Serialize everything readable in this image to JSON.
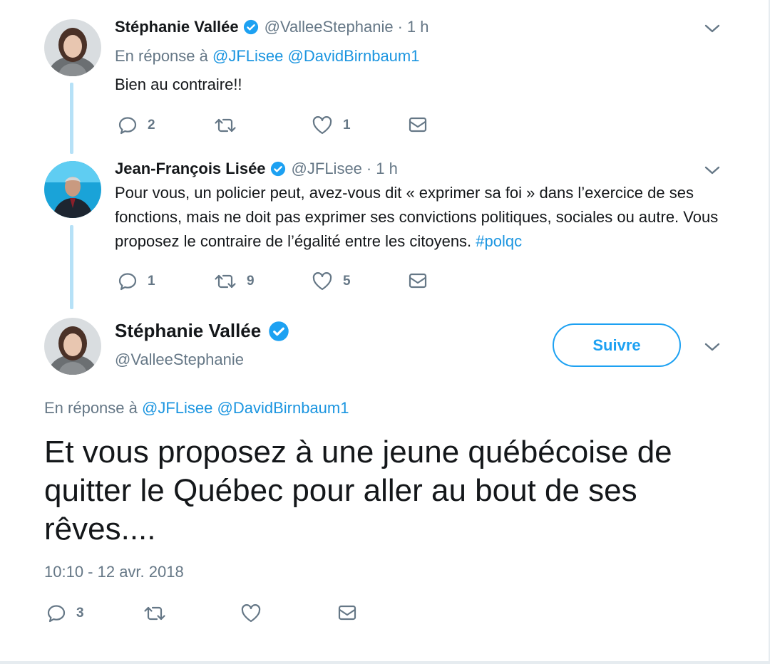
{
  "tweets": [
    {
      "author_name": "Stéphanie Vallée",
      "handle": "@ValleeStephanie",
      "time": "1 h",
      "reply_prefix": "En réponse à",
      "reply_mentions": [
        "@JFLisee",
        "@DavidBirnbaum1"
      ],
      "text": "Bien au contraire!!",
      "reply_count": "2",
      "retweet_count": "",
      "like_count": "1"
    },
    {
      "author_name": "Jean-François Lisée",
      "handle": "@JFLisee",
      "time": "1 h",
      "text": "Pour vous, un policier peut, avez-vous dit « exprimer sa foi » dans l’exercice de ses fonctions, mais ne doit pas exprimer ses convictions politiques, sociales ou autre. Vous proposez le contraire de l’égalité entre les citoyens.",
      "hashtag": "#polqc",
      "reply_count": "1",
      "retweet_count": "9",
      "like_count": "5"
    }
  ],
  "focused_tweet": {
    "author_name": "Stéphanie Vallée",
    "handle": "@ValleeStephanie",
    "follow_label": "Suivre",
    "reply_prefix": "En réponse à",
    "reply_mentions": [
      "@JFLisee",
      "@DavidBirnbaum1"
    ],
    "text": "Et vous proposez à une jeune québécoise de quitter le Québec pour aller au bout de ses rêves....",
    "timestamp": "10:10 - 12 avr. 2018",
    "reply_count": "3",
    "retweet_count": "",
    "like_count": ""
  },
  "icons": {
    "reply": "reply-icon",
    "retweet": "retweet-icon",
    "like": "heart-icon",
    "dm": "envelope-icon",
    "verified": "verified-badge-icon",
    "more": "chevron-down-icon"
  },
  "colors": {
    "link": "#1b95e0",
    "brand": "#1da1f2",
    "muted": "#657786",
    "thread_line": "#b6e1f7"
  }
}
